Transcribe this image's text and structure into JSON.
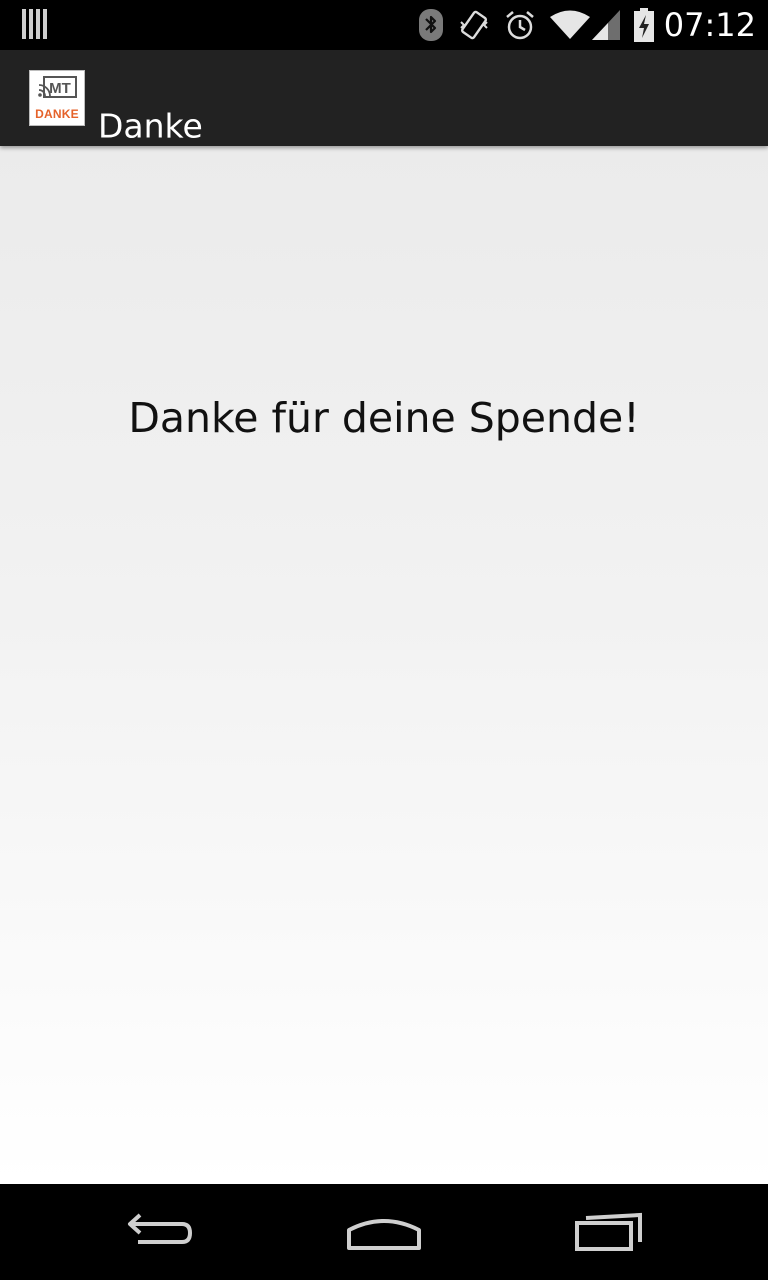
{
  "status_bar": {
    "time": "07:12",
    "icons": [
      "notification-bars-icon",
      "bluetooth-icon",
      "vibrate-icon",
      "alarm-icon",
      "wifi-icon",
      "signal-icon",
      "battery-charging-icon"
    ]
  },
  "action_bar": {
    "title": "Danke",
    "app_icon": {
      "name": "mt-danke-logo-icon",
      "logo_text": "MT",
      "label": "DANKE",
      "label_color": "#e5622a"
    }
  },
  "main": {
    "message": "Danke für deine Spende!"
  },
  "nav_bar": {
    "buttons": [
      "back-icon",
      "home-icon",
      "recent-apps-icon"
    ]
  }
}
